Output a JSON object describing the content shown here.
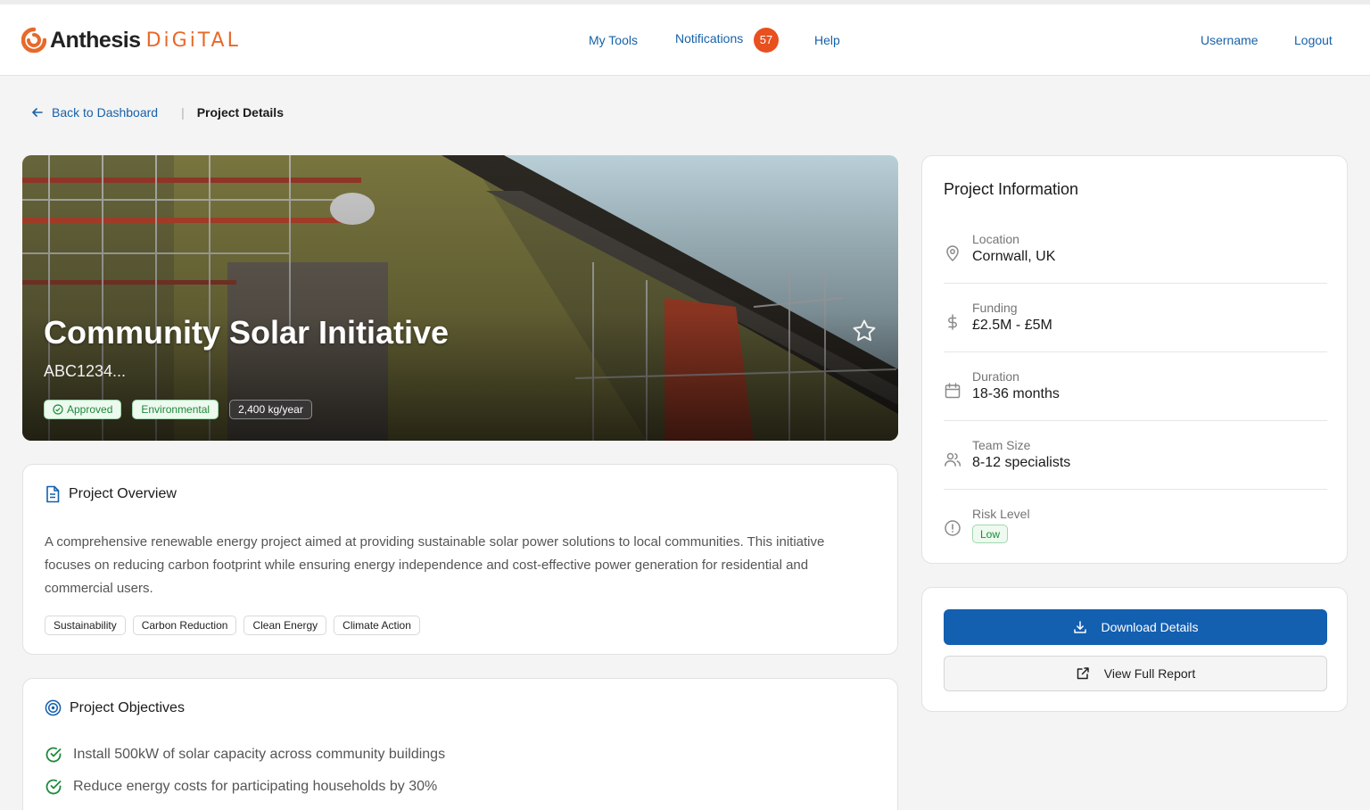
{
  "brand": {
    "name": "Anthesis",
    "suffix": "DiGiTAL",
    "accent": "#e8692a"
  },
  "nav": {
    "my_tools": "My Tools",
    "notifications": "Notifications",
    "notification_count": "57",
    "help": "Help",
    "username": "Username",
    "logout": "Logout"
  },
  "breadcrumb": {
    "back": "Back to Dashboard",
    "current": "Project Details"
  },
  "hero": {
    "title": "Community Solar Initiative",
    "id": "ABC1234...",
    "tags": {
      "status": "Approved",
      "category": "Environmental",
      "impact": "2,400 kg/year"
    }
  },
  "overview": {
    "title": "Project Overview",
    "text": "A comprehensive renewable energy project aimed at providing sustainable solar power solutions to local communities. This initiative focuses on reducing carbon footprint while ensuring energy independence and cost-effective power generation for residential and commercial users.",
    "chips": [
      "Sustainability",
      "Carbon Reduction",
      "Clean Energy",
      "Climate Action"
    ]
  },
  "objectives": {
    "title": "Project Objectives",
    "items": [
      "Install 500kW of solar capacity across community buildings",
      "Reduce energy costs for participating households by 30%"
    ]
  },
  "info": {
    "title": "Project Information",
    "location": {
      "label": "Location",
      "value": "Cornwall, UK"
    },
    "funding": {
      "label": "Funding",
      "value": "£2.5M - £5M"
    },
    "duration": {
      "label": "Duration",
      "value": "18-36 months"
    },
    "team": {
      "label": "Team Size",
      "value": "8-12 specialists"
    },
    "risk": {
      "label": "Risk Level",
      "value": "Low"
    }
  },
  "actions": {
    "download": "Download Details",
    "report": "View Full Report"
  },
  "colors": {
    "primary": "#135fb0",
    "link": "#1761a8",
    "badge": "#e8501f",
    "success": "#1d8a3a"
  }
}
